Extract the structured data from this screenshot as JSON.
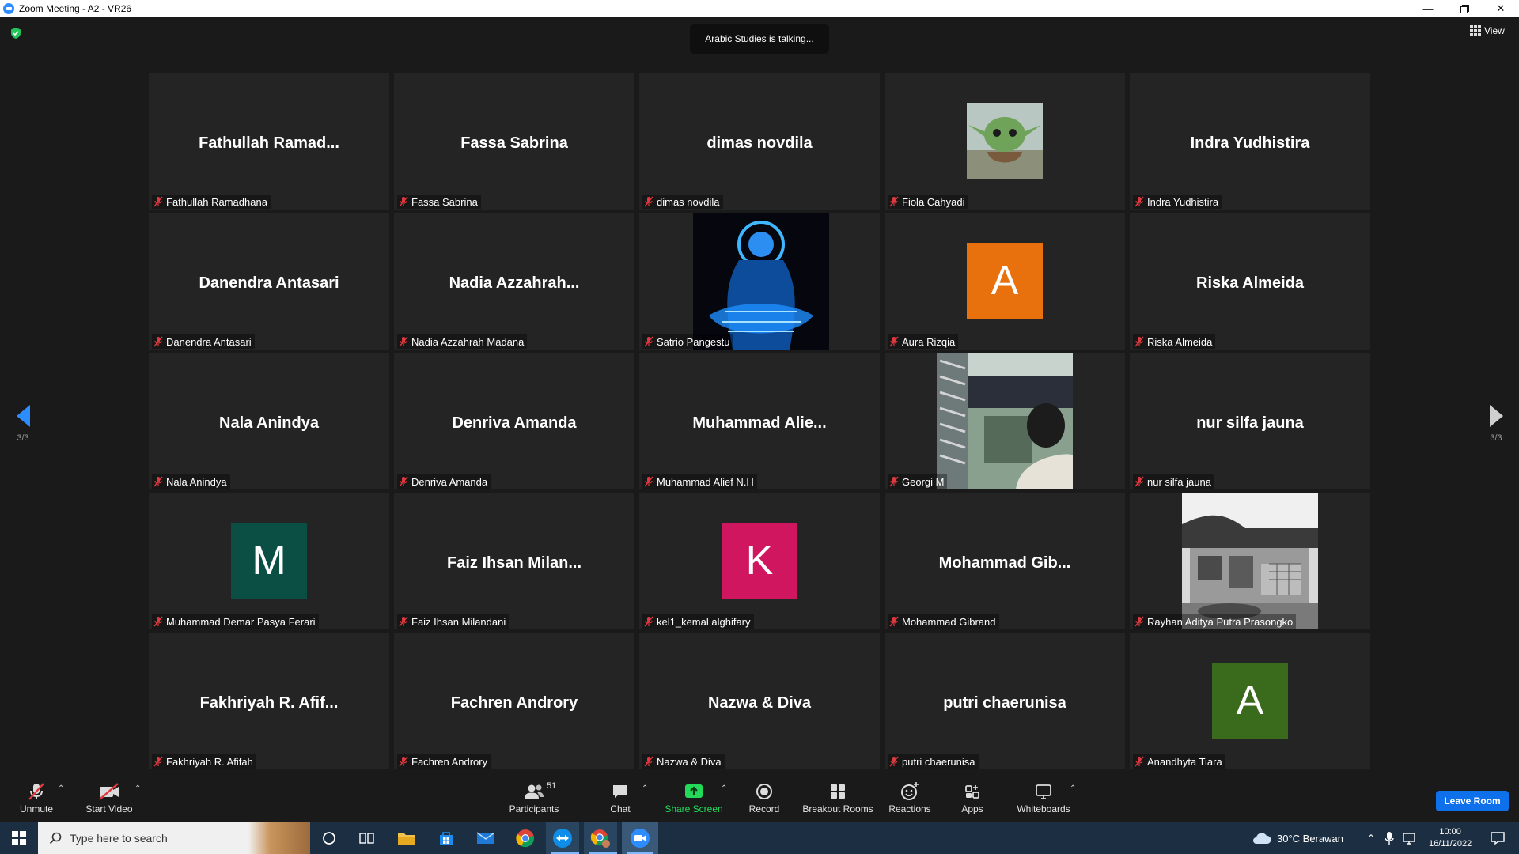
{
  "window": {
    "title": "Zoom Meeting - A2 - VR26"
  },
  "meeting": {
    "talking_banner": "Arabic Studies is talking...",
    "view_label": "View",
    "page_left": "3/3",
    "page_right": "3/3"
  },
  "tiles": [
    {
      "display": "Fathullah  Ramad...",
      "label": "Fathullah Ramadhana"
    },
    {
      "display": "Fassa Sabrina",
      "label": "Fassa Sabrina"
    },
    {
      "display": "dimas novdila",
      "label": "dimas novdila"
    },
    {
      "display": "",
      "label": "Fiola Cahyadi",
      "photo": "green-creature"
    },
    {
      "display": "Indra Yudhistira",
      "label": "Indra Yudhistira"
    },
    {
      "display": "Danendra Antasari",
      "label": "Danendra Antasari"
    },
    {
      "display": "Nadia  Azzahrah...",
      "label": "Nadia Azzahrah Madana"
    },
    {
      "display": "",
      "label": "Satrio Pangestu",
      "photo": "glowing-figure"
    },
    {
      "display": "",
      "label": "Aura Rizqia",
      "letter": "A",
      "color": "#e8700d"
    },
    {
      "display": "Riska Almeida",
      "label": "Riska Almeida"
    },
    {
      "display": "Nala Anindya",
      "label": "Nala Anindya"
    },
    {
      "display": "Denriva Amanda",
      "label": "Denriva Amanda"
    },
    {
      "display": "Muhammad  Alie...",
      "label": "Muhammad Alief N.H"
    },
    {
      "display": "",
      "label": "Georgi M",
      "photo": "person-outdoors"
    },
    {
      "display": "nur silfa jauna",
      "label": "nur silfa jauna"
    },
    {
      "display": "",
      "label": "Muhammad Demar Pasya Ferari",
      "letter": "M",
      "color": "#0b4f44"
    },
    {
      "display": "Faiz  Ihsan  Milan...",
      "label": "Faiz Ihsan Milandani"
    },
    {
      "display": "",
      "label": "kel1_kemal alghifary",
      "letter": "K",
      "color": "#d0165e"
    },
    {
      "display": "Mohammad  Gib...",
      "label": "Mohammad Gibrand"
    },
    {
      "display": "",
      "label": "Rayhan Aditya Putra Prasongko",
      "photo": "house-bw"
    },
    {
      "display": "Fakhriyah  R.  Afif...",
      "label": "Fakhriyah R. Afifah"
    },
    {
      "display": "Fachren Androry",
      "label": "Fachren Androry"
    },
    {
      "display": "Nazwa & Diva",
      "label": "Nazwa & Diva"
    },
    {
      "display": "putri chaerunisa",
      "label": "putri chaerunisa"
    },
    {
      "display": "",
      "label": "Anandhyta Tiara",
      "letter": "A",
      "color": "#3a6b1d"
    }
  ],
  "toolbar": {
    "unmute": "Unmute",
    "start_video": "Start Video",
    "participants": "Participants",
    "participants_count": "51",
    "chat": "Chat",
    "share_screen": "Share Screen",
    "record": "Record",
    "breakout_rooms": "Breakout Rooms",
    "reactions": "Reactions",
    "apps": "Apps",
    "whiteboards": "Whiteboards",
    "leave_room": "Leave Room"
  },
  "taskbar": {
    "search_placeholder": "Type here to search",
    "weather": "30°C  Berawan",
    "time": "10:00",
    "date": "16/11/2022"
  },
  "colors": {
    "accent": "#2d8cff",
    "leave": "#0e71eb",
    "share_green": "#23d959",
    "muted_red": "#e0383e"
  }
}
